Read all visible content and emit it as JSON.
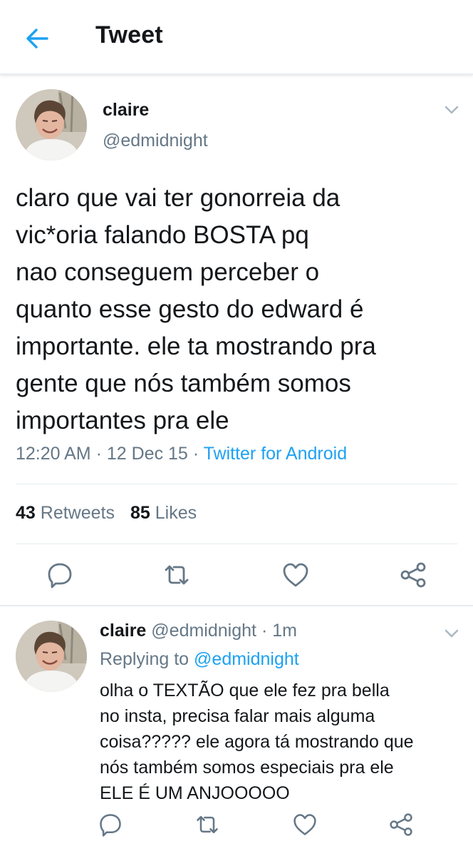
{
  "header": {
    "title": "Tweet",
    "back_icon": "arrow-left-icon",
    "accent_color": "#1da1f2"
  },
  "tweet": {
    "name": "claire",
    "handle": "@edmidnight",
    "text": "claro que vai ter gonorreia da\nvic*oria falando BOSTA pq\nnao conseguem perceber o\nquanto esse gesto do edward é\nimportante. ele ta mostrando pra\ngente que nós também somos\nimportantes pra ele",
    "time": "12:20 AM",
    "date": "12 Dec 15",
    "separator": "·",
    "source": "Twitter for Android",
    "retweets_count": "43",
    "retweets_label": "Retweets",
    "likes_count": "85",
    "likes_label": "Likes",
    "actions": [
      "reply-icon",
      "retweet-icon",
      "like-icon",
      "share-icon"
    ]
  },
  "reply": {
    "name": "claire",
    "handle": "@edmidnight",
    "separator": "·",
    "time": "1m",
    "replying_to_label": "Replying to",
    "replying_to_handle": "@edmidnight",
    "text": "olha o TEXTÃO que ele fez pra bella\nno insta, precisa falar mais alguma\ncoisa????? ele agora tá mostrando que\nnós também somos especiais pra ele\nELE É UM ANJOOOOO",
    "actions": [
      "reply-icon",
      "retweet-icon",
      "like-icon",
      "share-icon"
    ]
  }
}
